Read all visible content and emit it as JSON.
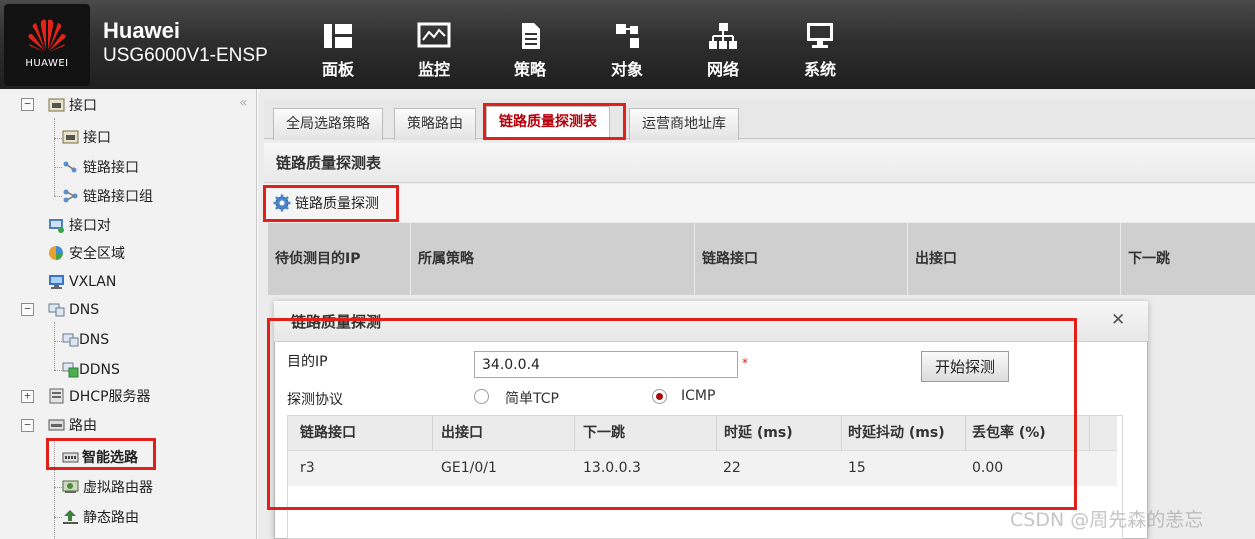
{
  "header": {
    "logo_text": "HUAWEI",
    "brand": "Huawei",
    "model": "USG6000V1-ENSP",
    "nav": [
      {
        "label": "面板",
        "icon": "dashboard-icon"
      },
      {
        "label": "监控",
        "icon": "monitor-chart-icon"
      },
      {
        "label": "策略",
        "icon": "policy-document-icon"
      },
      {
        "label": "对象",
        "icon": "object-blocks-icon"
      },
      {
        "label": "网络",
        "icon": "network-topology-icon"
      },
      {
        "label": "系统",
        "icon": "system-computer-icon"
      }
    ],
    "active_nav": "网络"
  },
  "sidebar": {
    "collapse_glyph": "«",
    "items": [
      {
        "label": "接口",
        "level": 0,
        "expander": "−",
        "icon": "interface-folder-icon"
      },
      {
        "label": "接口",
        "level": 1,
        "icon": "interface-icon"
      },
      {
        "label": "链路接口",
        "level": 1,
        "icon": "link-interface-icon"
      },
      {
        "label": "链路接口组",
        "level": 1,
        "icon": "link-interface-group-icon"
      },
      {
        "label": "接口对",
        "level": 0,
        "icon": "interface-pair-icon"
      },
      {
        "label": "安全区域",
        "level": 0,
        "icon": "security-zone-icon"
      },
      {
        "label": "VXLAN",
        "level": 0,
        "icon": "vxlan-icon"
      },
      {
        "label": "DNS",
        "level": 0,
        "expander": "−",
        "icon": "dns-folder-icon"
      },
      {
        "label": "DNS",
        "level": 1,
        "icon": "dns-icon"
      },
      {
        "label": "DDNS",
        "level": 1,
        "icon": "ddns-icon"
      },
      {
        "label": "DHCP服务器",
        "level": 0,
        "expander": "+",
        "icon": "dhcp-server-icon"
      },
      {
        "label": "路由",
        "level": 0,
        "expander": "−",
        "icon": "route-folder-icon"
      },
      {
        "label": "智能选路",
        "level": 1,
        "icon": "smart-routing-icon",
        "selected": true
      },
      {
        "label": "虚拟路由器",
        "level": 1,
        "icon": "virtual-router-icon"
      },
      {
        "label": "静态路由",
        "level": 1,
        "icon": "static-route-icon"
      }
    ]
  },
  "tabs": [
    {
      "label": "全局选路策略",
      "active": false
    },
    {
      "label": "策略路由",
      "active": false
    },
    {
      "label": "链路质量探测表",
      "active": true
    },
    {
      "label": "运营商地址库",
      "active": false
    }
  ],
  "panel": {
    "title": "链路质量探测表",
    "toolbar_button": "链路质量探测",
    "columns": [
      "待侦测目的IP",
      "所属策略",
      "链路接口",
      "出接口",
      "下一跳"
    ]
  },
  "dialog": {
    "title": "链路质量探测",
    "close_glyph": "✕",
    "target_ip_label": "目的IP",
    "target_ip_value": "34.0.0.4",
    "required_mark": "*",
    "protocol_label": "探测协议",
    "protocol_options": [
      {
        "label": "简单TCP",
        "selected": false
      },
      {
        "label": "ICMP",
        "selected": true
      }
    ],
    "start_button": "开始探测",
    "result_columns": [
      "链路接口",
      "出接口",
      "下一跳",
      "时延 (ms)",
      "时延抖动 (ms)",
      "丢包率 (%)"
    ],
    "result_rows": [
      {
        "link_if": "r3",
        "out_if": "GE1/0/1",
        "next_hop": "13.0.0.3",
        "delay": "22",
        "jitter": "15",
        "loss": "0.00"
      }
    ]
  },
  "colors": {
    "highlight_red": "#e0201b",
    "active_tab_text": "#b5000a",
    "header_bg": "#2f2f2f",
    "radio_dot": "#a80d0d"
  },
  "watermark": "CSDN @周先森的恙忘"
}
